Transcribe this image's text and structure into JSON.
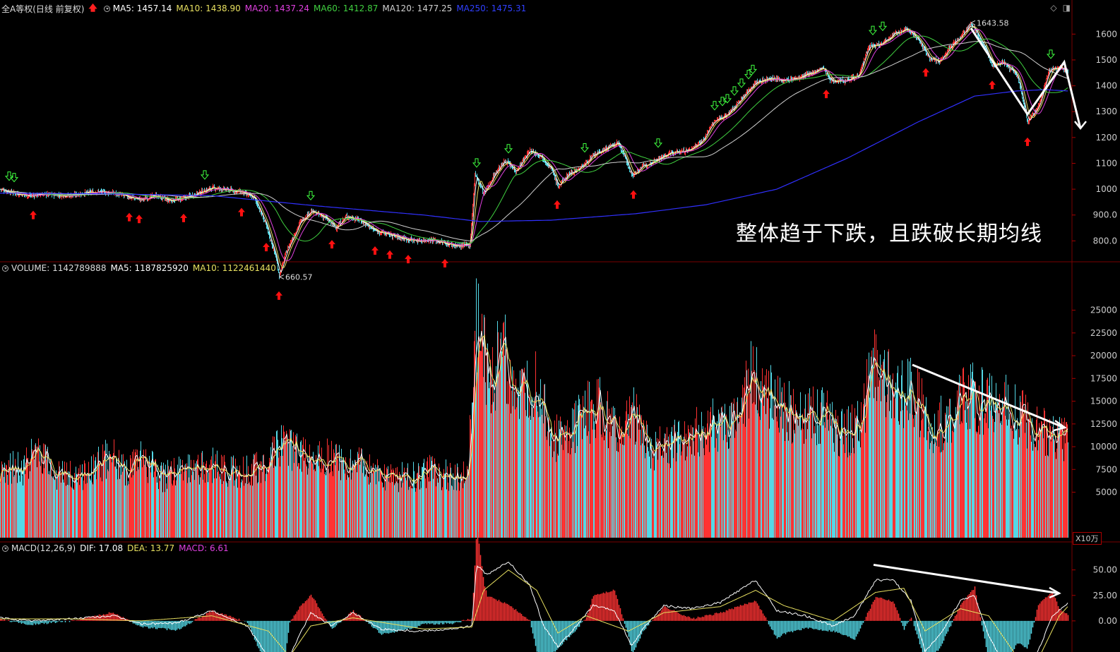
{
  "main_legend": {
    "title": "全A等权(日线 前复权)",
    "ma5": "MA5: 1457.14",
    "ma10": "MA10: 1438.90",
    "ma20": "MA20: 1437.24",
    "ma60": "MA60: 1412.87",
    "ma120": "MA120: 1477.25",
    "ma250": "MA250: 1475.31"
  },
  "volume_legend": {
    "title": "VOLUME: 1142789888",
    "ma5": "MA5: 1187825920",
    "ma10": "MA10: 1122461440"
  },
  "macd_legend": {
    "title": "MACD(12,26,9)",
    "dif": "DIF: 17.08",
    "dea": "DEA: 13.77",
    "macd": "MACD: 6.61"
  },
  "annotation": "整体趋于下跌，且跌破长期均线",
  "volume_unit": "X10万",
  "colors": {
    "up": "#ff3333",
    "down": "#54d8e6",
    "ma5": "#ffffff",
    "ma10": "#e8e060",
    "ma20": "#e040e0",
    "ma60": "#40d040",
    "ma120": "#d0d0d0",
    "ma250": "#3030ff",
    "grid": "#7a0000"
  },
  "chart_data": [
    {
      "type": "line",
      "name": "price",
      "ylim": [
        700,
        1650
      ],
      "yticks": [
        "800.0",
        "900.0",
        "1000",
        "1100",
        "1200",
        "1300",
        "1400",
        "1500",
        "1600"
      ],
      "ytick_values": [
        800,
        900,
        1000,
        1100,
        1200,
        1300,
        1400,
        1500,
        1600
      ],
      "high_label": "1643.58",
      "low_label": "660.57",
      "anchors": [
        [
          0,
          1000
        ],
        [
          20,
          985
        ],
        [
          40,
          975
        ],
        [
          60,
          980
        ],
        [
          80,
          978
        ],
        [
          100,
          975
        ],
        [
          120,
          985
        ],
        [
          140,
          990
        ],
        [
          160,
          985
        ],
        [
          180,
          970
        ],
        [
          200,
          960
        ],
        [
          220,
          975
        ],
        [
          240,
          955
        ],
        [
          260,
          965
        ],
        [
          280,
          985
        ],
        [
          300,
          1005
        ],
        [
          320,
          998
        ],
        [
          340,
          990
        ],
        [
          360,
          965
        ],
        [
          375,
          870
        ],
        [
          390,
          740
        ],
        [
          395,
          665
        ],
        [
          405,
          760
        ],
        [
          425,
          875
        ],
        [
          440,
          915
        ],
        [
          460,
          890
        ],
        [
          475,
          850
        ],
        [
          490,
          895
        ],
        [
          510,
          880
        ],
        [
          530,
          840
        ],
        [
          550,
          825
        ],
        [
          570,
          810
        ],
        [
          590,
          800
        ],
        [
          610,
          805
        ],
        [
          630,
          790
        ],
        [
          650,
          780
        ],
        [
          665,
          785
        ],
        [
          672,
          1060
        ],
        [
          685,
          980
        ],
        [
          700,
          1060
        ],
        [
          715,
          1110
        ],
        [
          730,
          1070
        ],
        [
          750,
          1150
        ],
        [
          765,
          1130
        ],
        [
          780,
          1080
        ],
        [
          790,
          1010
        ],
        [
          805,
          1060
        ],
        [
          820,
          1080
        ],
        [
          840,
          1130
        ],
        [
          860,
          1160
        ],
        [
          875,
          1180
        ],
        [
          885,
          1120
        ],
        [
          895,
          1050
        ],
        [
          905,
          1080
        ],
        [
          925,
          1110
        ],
        [
          950,
          1140
        ],
        [
          975,
          1150
        ],
        [
          995,
          1190
        ],
        [
          1010,
          1260
        ],
        [
          1030,
          1290
        ],
        [
          1050,
          1350
        ],
        [
          1068,
          1410
        ],
        [
          1090,
          1430
        ],
        [
          1110,
          1420
        ],
        [
          1130,
          1430
        ],
        [
          1150,
          1450
        ],
        [
          1165,
          1470
        ],
        [
          1175,
          1420
        ],
        [
          1195,
          1420
        ],
        [
          1215,
          1440
        ],
        [
          1230,
          1550
        ],
        [
          1245,
          1560
        ],
        [
          1265,
          1600
        ],
        [
          1285,
          1620
        ],
        [
          1300,
          1580
        ],
        [
          1315,
          1510
        ],
        [
          1330,
          1490
        ],
        [
          1345,
          1550
        ],
        [
          1360,
          1590
        ],
        [
          1375,
          1640
        ],
        [
          1390,
          1570
        ],
        [
          1405,
          1480
        ],
        [
          1420,
          1490
        ],
        [
          1440,
          1440
        ],
        [
          1455,
          1260
        ],
        [
          1470,
          1320
        ],
        [
          1485,
          1460
        ],
        [
          1500,
          1470
        ],
        [
          1512,
          1455
        ]
      ],
      "ma_offsets": {
        "ma5": [
          0,
          6
        ],
        "ma10": [
          0,
          12
        ],
        "ma20": [
          0,
          22
        ],
        "ma60": [
          0,
          48
        ],
        "ma120": [
          0,
          90
        ]
      },
      "ma250_anchors": [
        [
          0,
          985
        ],
        [
          150,
          982
        ],
        [
          300,
          975
        ],
        [
          450,
          935
        ],
        [
          600,
          900
        ],
        [
          680,
          875
        ],
        [
          780,
          880
        ],
        [
          900,
          905
        ],
        [
          1000,
          940
        ],
        [
          1100,
          1000
        ],
        [
          1200,
          1120
        ],
        [
          1300,
          1260
        ],
        [
          1380,
          1360
        ],
        [
          1440,
          1380
        ],
        [
          1480,
          1385
        ],
        [
          1512,
          1380
        ]
      ],
      "up_arrows_x": [
        47,
        183,
        197,
        260,
        342,
        377,
        395,
        470,
        531,
        552,
        578,
        630,
        789,
        897,
        1170,
        1311,
        1405,
        1455
      ],
      "down_arrows_x": [
        13,
        20,
        290,
        440,
        675,
        720,
        828,
        932,
        1012,
        1023,
        1030,
        1040,
        1050,
        1060,
        1066,
        1236,
        1250,
        1488
      ]
    },
    {
      "type": "bar",
      "name": "volume",
      "unit": "X10万",
      "ylim": [
        0,
        29000
      ],
      "yticks": [
        "5000",
        "7500",
        "10000",
        "12500",
        "15000",
        "17500",
        "20000",
        "22500",
        "25000"
      ],
      "ytick_values": [
        5000,
        7500,
        10000,
        12500,
        15000,
        17500,
        20000,
        22500,
        25000
      ],
      "anchors": [
        [
          0,
          8000
        ],
        [
          30,
          7800
        ],
        [
          57,
          10000
        ],
        [
          80,
          7000
        ],
        [
          120,
          7200
        ],
        [
          160,
          9500
        ],
        [
          180,
          7200
        ],
        [
          200,
          9000
        ],
        [
          230,
          6800
        ],
        [
          270,
          8000
        ],
        [
          300,
          8200
        ],
        [
          340,
          7200
        ],
        [
          370,
          8000
        ],
        [
          395,
          10500
        ],
        [
          420,
          9500
        ],
        [
          460,
          9000
        ],
        [
          500,
          8500
        ],
        [
          540,
          7000
        ],
        [
          580,
          6800
        ],
        [
          610,
          7500
        ],
        [
          640,
          7000
        ],
        [
          660,
          7000
        ],
        [
          668,
          14000
        ],
        [
          675,
          25000
        ],
        [
          690,
          18000
        ],
        [
          715,
          21000
        ],
        [
          735,
          15000
        ],
        [
          760,
          17500
        ],
        [
          780,
          12000
        ],
        [
          800,
          10500
        ],
        [
          825,
          14000
        ],
        [
          850,
          14500
        ],
        [
          880,
          11000
        ],
        [
          895,
          14000
        ],
        [
          920,
          10000
        ],
        [
          950,
          10500
        ],
        [
          1000,
          12500
        ],
        [
          1040,
          13000
        ],
        [
          1060,
          18000
        ],
        [
          1080,
          16500
        ],
        [
          1100,
          15000
        ],
        [
          1130,
          13500
        ],
        [
          1160,
          14000
        ],
        [
          1190,
          12000
        ],
        [
          1215,
          12500
        ],
        [
          1235,
          19500
        ],
        [
          1260,
          17000
        ],
        [
          1290,
          16500
        ],
        [
          1320,
          12500
        ],
        [
          1345,
          13500
        ],
        [
          1370,
          16500
        ],
        [
          1400,
          15000
        ],
        [
          1430,
          15000
        ],
        [
          1460,
          12500
        ],
        [
          1490,
          12000
        ],
        [
          1512,
          11500
        ]
      ]
    },
    {
      "type": "bar",
      "name": "macd",
      "ylim": [
        -25,
        65
      ],
      "yticks": [
        "0.00",
        "25.00",
        "50.00"
      ],
      "ytick_values": [
        0,
        25,
        50
      ],
      "dif_anchors": [
        [
          0,
          3
        ],
        [
          40,
          0
        ],
        [
          100,
          2
        ],
        [
          160,
          5
        ],
        [
          200,
          -3
        ],
        [
          250,
          -2
        ],
        [
          300,
          10
        ],
        [
          350,
          -5
        ],
        [
          375,
          -30
        ],
        [
          395,
          -60
        ],
        [
          420,
          -20
        ],
        [
          440,
          8
        ],
        [
          470,
          -5
        ],
        [
          500,
          8
        ],
        [
          540,
          -8
        ],
        [
          590,
          -10
        ],
        [
          640,
          -8
        ],
        [
          668,
          -5
        ],
        [
          675,
          55
        ],
        [
          690,
          45
        ],
        [
          720,
          58
        ],
        [
          750,
          35
        ],
        [
          770,
          -5
        ],
        [
          790,
          -25
        ],
        [
          810,
          -10
        ],
        [
          840,
          15
        ],
        [
          870,
          10
        ],
        [
          895,
          -25
        ],
        [
          910,
          -8
        ],
        [
          940,
          15
        ],
        [
          980,
          12
        ],
        [
          1020,
          18
        ],
        [
          1070,
          40
        ],
        [
          1100,
          10
        ],
        [
          1140,
          5
        ],
        [
          1180,
          -5
        ],
        [
          1210,
          5
        ],
        [
          1240,
          40
        ],
        [
          1265,
          40
        ],
        [
          1290,
          20
        ],
        [
          1310,
          -30
        ],
        [
          1330,
          -15
        ],
        [
          1360,
          20
        ],
        [
          1380,
          25
        ],
        [
          1400,
          -15
        ],
        [
          1420,
          -40
        ],
        [
          1455,
          -50
        ],
        [
          1470,
          -30
        ],
        [
          1490,
          5
        ],
        [
          1512,
          17
        ]
      ],
      "dea_anchors": [
        [
          0,
          2
        ],
        [
          100,
          2
        ],
        [
          200,
          0
        ],
        [
          300,
          5
        ],
        [
          380,
          -10
        ],
        [
          410,
          -35
        ],
        [
          440,
          -5
        ],
        [
          500,
          3
        ],
        [
          600,
          -8
        ],
        [
          668,
          -6
        ],
        [
          685,
          30
        ],
        [
          720,
          50
        ],
        [
          760,
          30
        ],
        [
          790,
          -12
        ],
        [
          830,
          5
        ],
        [
          890,
          -10
        ],
        [
          940,
          8
        ],
        [
          1020,
          14
        ],
        [
          1070,
          30
        ],
        [
          1110,
          15
        ],
        [
          1180,
          0
        ],
        [
          1240,
          28
        ],
        [
          1280,
          32
        ],
        [
          1310,
          -10
        ],
        [
          1360,
          12
        ],
        [
          1400,
          5
        ],
        [
          1440,
          -35
        ],
        [
          1470,
          -38
        ],
        [
          1500,
          5
        ],
        [
          1512,
          14
        ]
      ],
      "white_trend_macd": [
        [
          1237,
          55
        ],
        [
          1500,
          27
        ]
      ]
    }
  ]
}
